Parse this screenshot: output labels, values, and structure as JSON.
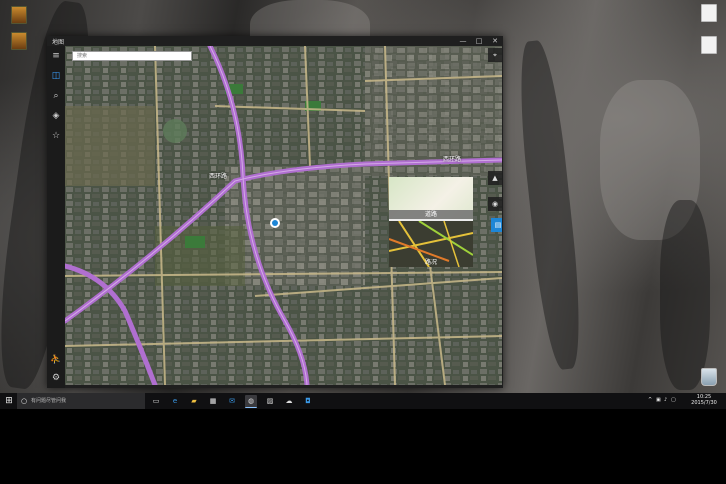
{
  "desktop": {
    "icons_left": [
      {
        "label": ""
      },
      {
        "label": ""
      }
    ],
    "icons_right": [
      {
        "label": ""
      },
      {
        "label": ""
      },
      {
        "label": ""
      }
    ]
  },
  "window": {
    "title": "地图",
    "minimize": "—",
    "maximize": "□",
    "close": "✕"
  },
  "sidebar": {
    "menu_icon": "hamburger-icon",
    "items": [
      {
        "icon": "map-icon",
        "glyph": "◫"
      },
      {
        "icon": "search-icon",
        "glyph": "⌕"
      },
      {
        "icon": "directions-icon",
        "glyph": "◈"
      },
      {
        "icon": "favorites-icon",
        "glyph": "☆"
      }
    ],
    "bottom": [
      {
        "icon": "person-icon",
        "glyph": "⛹"
      },
      {
        "icon": "settings-icon",
        "glyph": "⚙"
      }
    ]
  },
  "search": {
    "placeholder": "搜索"
  },
  "map": {
    "road_labels": [
      "西环路",
      "西环路"
    ],
    "controls": [
      {
        "name": "compass-icon",
        "glyph": "⌖"
      },
      {
        "name": "tilt-icon",
        "glyph": "▲"
      },
      {
        "name": "locate-icon",
        "glyph": "◉"
      },
      {
        "name": "layers-icon",
        "glyph": "▤"
      }
    ],
    "layers": {
      "road": "道路",
      "traffic": "路况"
    }
  },
  "taskbar": {
    "start_glyph": "⊞",
    "search_placeholder": "有问题尽管问我",
    "apps": [
      {
        "name": "task-view-icon",
        "glyph": "▭"
      },
      {
        "name": "edge-icon",
        "glyph": "e"
      },
      {
        "name": "file-explorer-icon",
        "glyph": "▰"
      },
      {
        "name": "store-icon",
        "glyph": "▦"
      },
      {
        "name": "mail-icon",
        "glyph": "✉"
      },
      {
        "name": "maps-app-icon",
        "glyph": "◍"
      },
      {
        "name": "photos-icon",
        "glyph": "▨"
      },
      {
        "name": "weather-icon",
        "glyph": "☁"
      },
      {
        "name": "app-icon",
        "glyph": "◘"
      }
    ],
    "clock_time": "10:25",
    "clock_date": "2015/7/30"
  },
  "colors": {
    "accent": "#1d86d6",
    "highway": "#b06fd0",
    "window_chrome": "#1f1f1f",
    "taskbar": "#101012"
  }
}
